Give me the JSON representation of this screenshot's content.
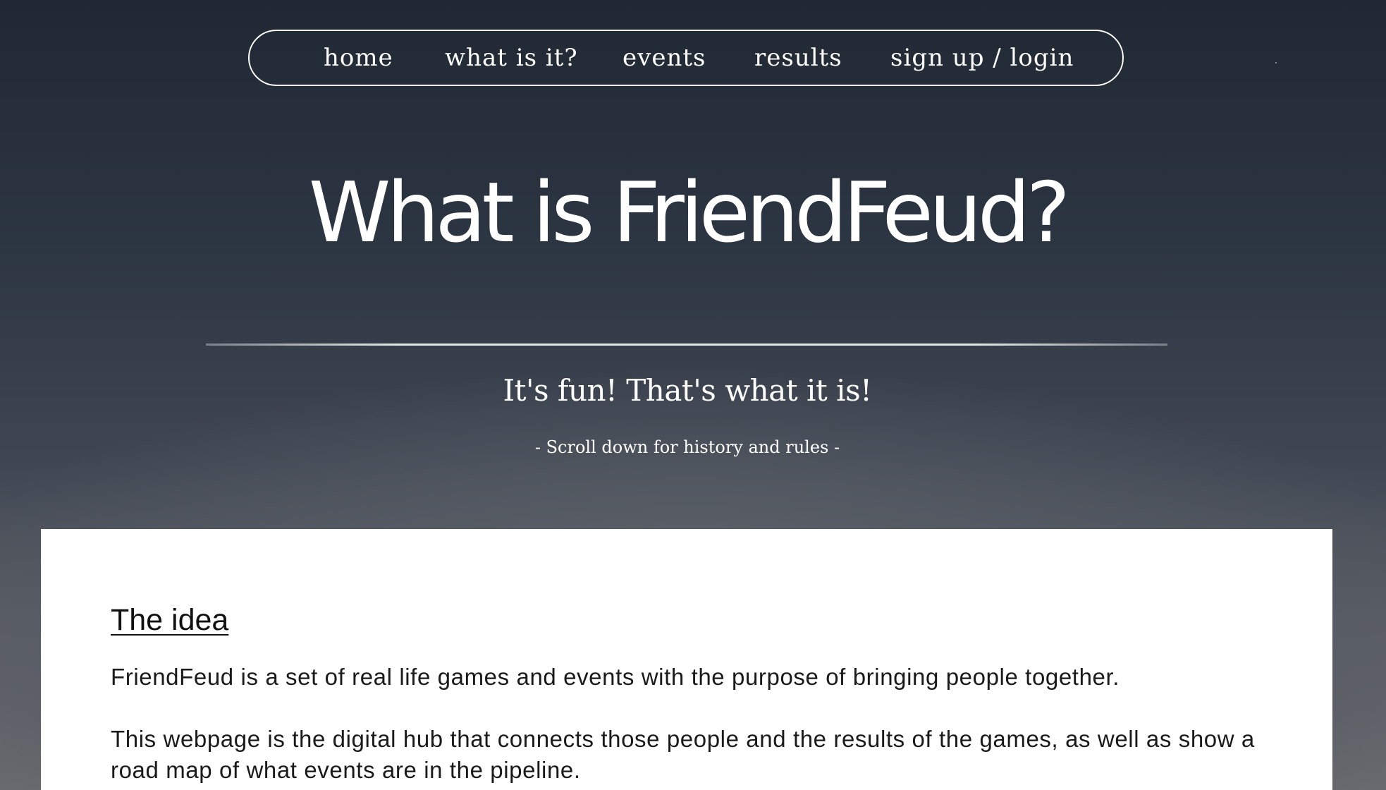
{
  "nav": {
    "items": [
      {
        "label": "home"
      },
      {
        "label": "what is it?"
      },
      {
        "label": "events"
      },
      {
        "label": "results"
      },
      {
        "label": "sign up / login"
      }
    ]
  },
  "hero": {
    "title": "What is FriendFeud?",
    "tagline": "It's fun! That's what it is!",
    "hint": "- Scroll down for history and rules -"
  },
  "content": {
    "heading": "The idea",
    "paragraphs": [
      "FriendFeud is a set of real life games and events with the purpose of bringing people together.",
      "This webpage is the digital hub that connects those people and the results of the games, as well as show a road map of what events are in the pipeline."
    ]
  },
  "colors": {
    "background_top": "#202833",
    "background_bottom": "#6b6c70",
    "text_light": "#ffffff",
    "panel": "#ffffff",
    "text_dark": "#111111"
  }
}
